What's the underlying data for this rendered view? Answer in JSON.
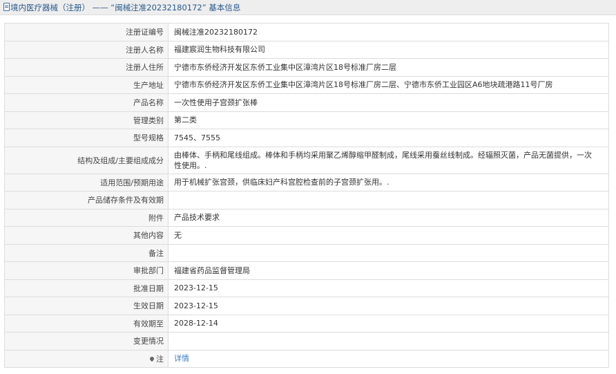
{
  "header": {
    "title": "境内医疗器械（注册） —— “闽械注准20232180172” 基本信息"
  },
  "rows": [
    {
      "label": "注册证编号",
      "value": "闽械注准20232180172"
    },
    {
      "label": "注册人名称",
      "value": "福建宸润生物科技有限公司"
    },
    {
      "label": "注册人住所",
      "value": "宁德市东侨经济开发区东侨工业集中区漳湾片区18号标准厂房二层"
    },
    {
      "label": "生产地址",
      "value": "宁德市东侨经济开发区东侨工业集中区漳湾片区18号标准厂房二层、宁德市东侨工业园区A6地块疏港路11号厂房"
    },
    {
      "label": "产品名称",
      "value": "一次性使用子宫颈扩张棒"
    },
    {
      "label": "管理类别",
      "value": "第二类"
    },
    {
      "label": "型号规格",
      "value": "7545、7555"
    },
    {
      "label": "结构及组成/主要组成成分",
      "value": "由棒体、手柄和尾线组成。棒体和手柄均采用聚乙烯醇缩甲醛制成，尾线采用蚕丝线制成。经辐照灭菌，产品无菌提供，一次性使用。."
    },
    {
      "label": "适用范围/预期用途",
      "value": "用于机械扩张宫颈，供临床妇产科宫腔检查前的子宫颈扩张用。."
    },
    {
      "label": "产品储存条件及有效期",
      "value": ""
    },
    {
      "label": "附件",
      "value": "产品技术要求"
    },
    {
      "label": "其他内容",
      "value": "无"
    },
    {
      "label": "备注",
      "value": ""
    },
    {
      "label": "审批部门",
      "value": "福建省药品监督管理局"
    },
    {
      "label": "批准日期",
      "value": "2023-12-15"
    },
    {
      "label": "生效日期",
      "value": "2023-12-15"
    },
    {
      "label": "有效期至",
      "value": "2028-12-14"
    },
    {
      "label": "变更情况",
      "value": ""
    },
    {
      "label": "注",
      "value": "详情"
    }
  ]
}
